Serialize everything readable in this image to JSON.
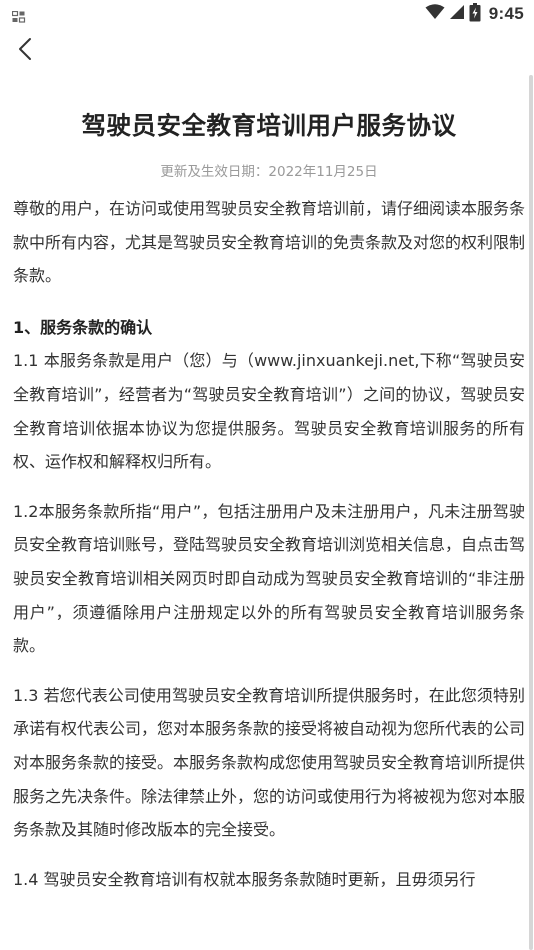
{
  "status_bar": {
    "time": "9:45",
    "left_icon": "notification-grid-icon",
    "icons": [
      "wifi-icon",
      "cellular-signal-icon",
      "battery-icon"
    ]
  },
  "nav": {
    "back_icon": "chevron-left-icon"
  },
  "document": {
    "title": "驾驶员安全教育培训用户服务协议",
    "effective_date": "更新及生效日期：2022年11月25日",
    "intro": "尊敬的用户，在访问或使用驾驶员安全教育培训前，请仔细阅读本服务条款中所有内容，尤其是驾驶员安全教育培训的免责条款及对您的权利限制条款。",
    "section1_heading": "1、服务条款的确认",
    "clause_1_1": "1.1 本服务条款是用户（您）与（www.jinxuankeji.net,下称“驾驶员安全教育培训”，经营者为“驾驶员安全教育培训”）之间的协议，驾驶员安全教育培训依据本协议为您提供服务。驾驶员安全教育培训服务的所有权、运作权和解释权归所有。",
    "clause_1_2": "1.2本服务条款所指“用户”，包括注册用户及未注册用户，凡未注册驾驶员安全教育培训账号，登陆驾驶员安全教育培训浏览相关信息，自点击驾驶员安全教育培训相关网页时即自动成为驾驶员安全教育培训的“非注册用户”，须遵循除用户注册规定以外的所有驾驶员安全教育培训服务条款。",
    "clause_1_3": "1.3 若您代表公司使用驾驶员安全教育培训所提供服务时，在此您须特别承诺有权代表公司，您对本服务条款的接受将被自动视为您所代表的公司对本服务条款的接受。本服务条款构成您使用驾驶员安全教育培训所提供服务之先决条件。除法律禁止外，您的访问或使用行为将被视为您对本服务条款及其随时修改版本的完全接受。",
    "clause_1_4": "1.4 驾驶员安全教育培训有权就本服务条款随时更新，且毋须另行"
  }
}
